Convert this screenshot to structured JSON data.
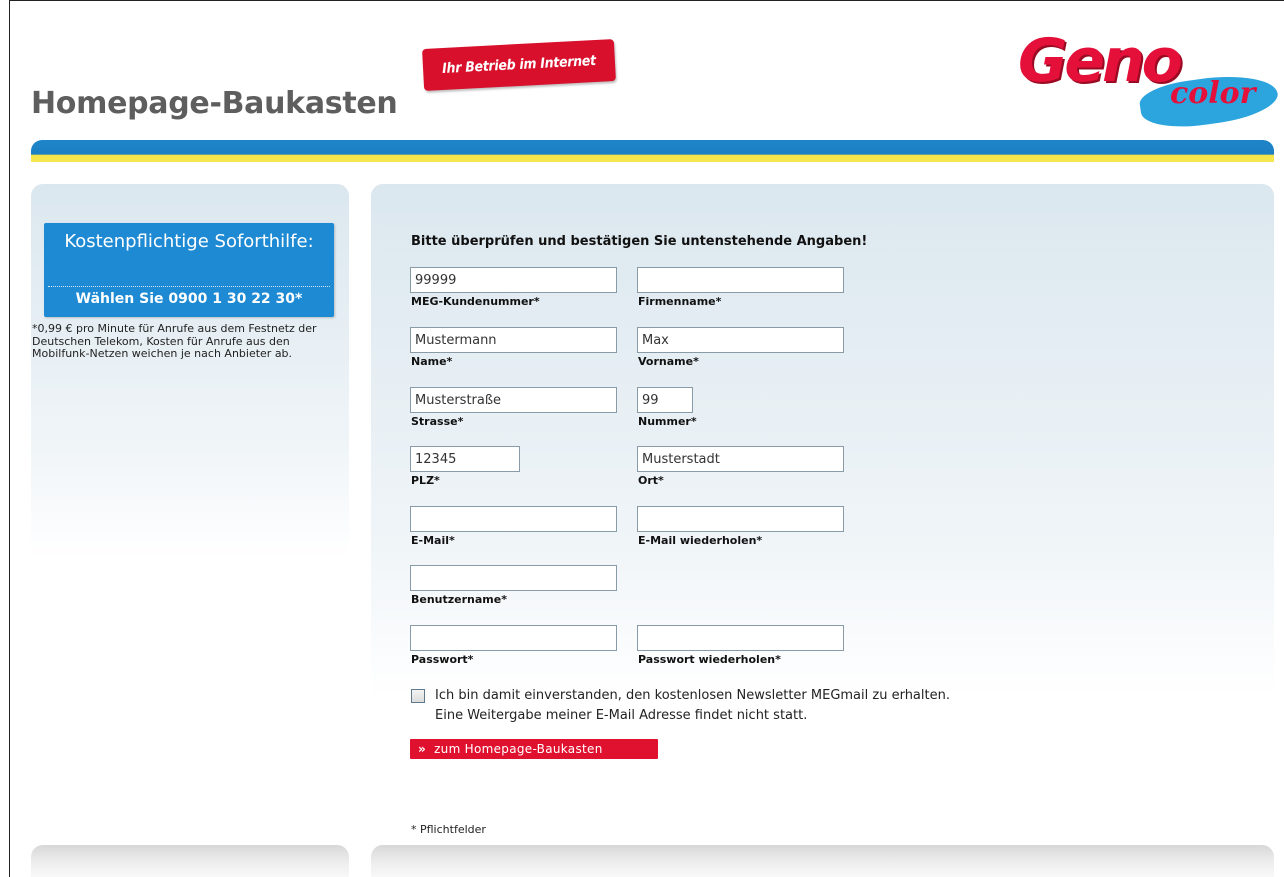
{
  "header": {
    "site_title": "Homepage-Baukasten",
    "tagline": "Ihr Betrieb im Internet",
    "logo_main": "Geno",
    "logo_sub": "color"
  },
  "sidebar": {
    "hotline_title": "Kostenpflichtige Soforthilfe:",
    "hotline_number": "Wählen Sie 0900 1 30 22 30*",
    "hotline_note": "*0,99 € pro Minute für Anrufe aus dem Festnetz der Deutschen Telekom, Kosten für Anrufe aus den Mobilfunk-Netzen weichen je nach Anbieter ab."
  },
  "form": {
    "heading": "Bitte überprüfen und bestätigen Sie untenstehende Angaben!",
    "fields": {
      "kundennummer": {
        "label": "MEG-Kundenummer*",
        "value": "99999"
      },
      "firmenname": {
        "label": "Firmenname*",
        "value": ""
      },
      "name": {
        "label": "Name*",
        "value": "Mustermann"
      },
      "vorname": {
        "label": "Vorname*",
        "value": "Max"
      },
      "strasse": {
        "label": "Strasse*",
        "value": "Musterstraße"
      },
      "nummer": {
        "label": "Nummer*",
        "value": "99"
      },
      "plz": {
        "label": "PLZ*",
        "value": "12345"
      },
      "ort": {
        "label": "Ort*",
        "value": "Musterstadt"
      },
      "email": {
        "label": "E-Mail*",
        "value": ""
      },
      "email_repeat": {
        "label": "E-Mail wiederholen*",
        "value": ""
      },
      "benutzername": {
        "label": "Benutzername*",
        "value": ""
      },
      "passwort": {
        "label": "Passwort*",
        "value": ""
      },
      "passwort_repeat": {
        "label": "Passwort wiederholen*",
        "value": ""
      }
    },
    "newsletter": {
      "line1": "Ich bin damit einverstanden, den kostenlosen Newsletter MEGmail zu erhalten.",
      "line2": "Eine Weitergabe meiner E-Mail Adresse findet nicht statt.",
      "checked": false
    },
    "submit_chevron": "»",
    "submit_label": "zum Homepage-Baukasten",
    "required_note": "* Pflichtfelder"
  },
  "colors": {
    "brand_blue": "#1e8ad3",
    "brand_red": "#e0102f",
    "accent_yellow": "#f7e84f"
  }
}
